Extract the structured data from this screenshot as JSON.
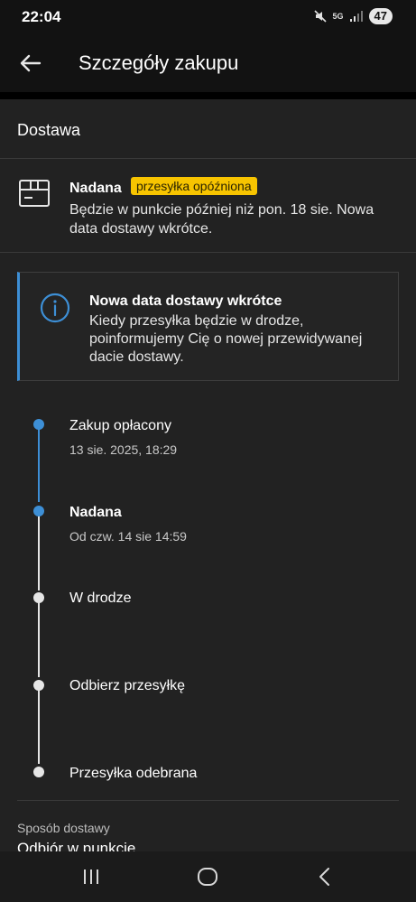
{
  "status_bar": {
    "time": "22:04",
    "network": "5G",
    "battery": "47",
    "icons": [
      "mute-icon",
      "network-5g-icon",
      "signal-icon",
      "battery-icon"
    ]
  },
  "app_bar": {
    "title": "Szczegóły zakupu",
    "back_icon": "arrow-left-icon"
  },
  "section": {
    "title": "Dostawa"
  },
  "shipment": {
    "status": "Nadana",
    "badge": "przesyłka opóźniona",
    "description": "Będzie w punkcie później niż pon. 18 sie. Nowa data dostawy wkrótce.",
    "icon": "package-icon"
  },
  "info": {
    "title": "Nowa data dostawy wkrótce",
    "text": "Kiedy przesyłka będzie w drodze, poinformujemy Cię o nowej przewidywanej dacie dostawy.",
    "icon": "info-icon"
  },
  "timeline": [
    {
      "label": "Zakup opłacony",
      "sub": "13 sie. 2025, 18:29",
      "state": "done"
    },
    {
      "label": "Nadana",
      "sub": "Od czw. 14 sie 14:59",
      "state": "current"
    },
    {
      "label": "W drodze",
      "sub": "",
      "state": "pending"
    },
    {
      "label": "Odbierz przesyłkę",
      "sub": "",
      "state": "pending"
    },
    {
      "label": "Przesyłka odebrana",
      "sub": "",
      "state": "pending"
    }
  ],
  "delivery_method": {
    "label": "Sposób dostawy",
    "value": "Odbiór w punkcie"
  },
  "navbar": {
    "icons": [
      "recent-apps-icon",
      "home-icon",
      "back-icon"
    ]
  },
  "colors": {
    "accent": "#3d8fd6",
    "badge": "#f7c400",
    "background": "#222222"
  }
}
